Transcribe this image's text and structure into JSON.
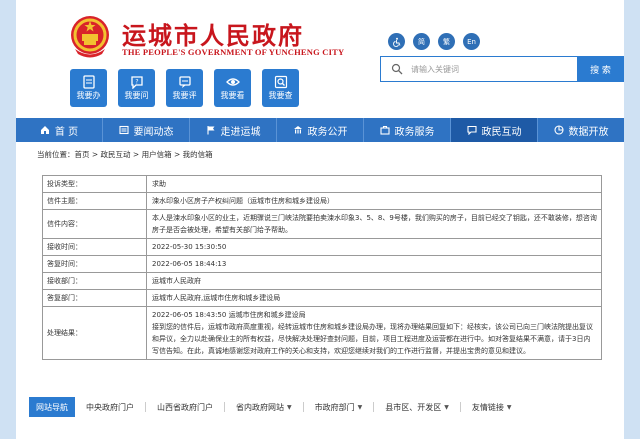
{
  "header": {
    "site_title": "运城市人民政府",
    "site_subtitle": "THE PEOPLE'S GOVERNMENT OF YUNCHENG  CITY",
    "quick_links": [
      {
        "label": "我要办",
        "icon": "form-icon"
      },
      {
        "label": "我要问",
        "icon": "question-icon"
      },
      {
        "label": "我要评",
        "icon": "feedback-icon"
      },
      {
        "label": "我要看",
        "icon": "eye-icon"
      },
      {
        "label": "我要查",
        "icon": "search-icon"
      }
    ],
    "accessibility": [
      {
        "label": "",
        "icon": "wheelchair-icon"
      },
      {
        "label": "简"
      },
      {
        "label": "繁"
      },
      {
        "label": "En"
      }
    ]
  },
  "search": {
    "placeholder": "请输入关键词",
    "button_label": "搜 索"
  },
  "nav": [
    {
      "label": "首 页",
      "icon": "home-icon"
    },
    {
      "label": "要闻动态",
      "icon": "news-icon"
    },
    {
      "label": "走进运城",
      "icon": "flag-icon"
    },
    {
      "label": "政务公开",
      "icon": "building-icon"
    },
    {
      "label": "政务服务",
      "icon": "service-icon"
    },
    {
      "label": "政民互动",
      "icon": "chat-icon",
      "active": true
    },
    {
      "label": "数据开放",
      "icon": "data-icon"
    }
  ],
  "breadcrumb": "当前位置：首页 > 政民互动 > 用户信箱 > 我的信箱",
  "letter": {
    "rows": [
      {
        "key": "投诉类型：",
        "value": "求助"
      },
      {
        "key": "信件主题：",
        "value": "涑水印象小区房子产权纠问题（运城市住房和城乡建设局）"
      },
      {
        "key": "信件内容：",
        "value": "本人是涑水印象小区的业主，近期骤说三门峡法院要拍卖涑水印象3、5、8、9号楼，我们购买的房子，目前已经交了钥匙，还不敢装修，想咨询房子是否会被处理，希望有关部门给予帮助。"
      },
      {
        "key": "接收时间：",
        "value": "2022-05-30 15:30:50"
      },
      {
        "key": "答复时间：",
        "value": "2022-06-05 18:44:13"
      },
      {
        "key": "接收部门：",
        "value": "运城市人民政府"
      },
      {
        "key": "答复部门：",
        "value": "运城市人民政府,运城市住房和城乡建设局"
      },
      {
        "key": "处理结果：",
        "value": "2022-06-05 18:43:50 运城市住房和城乡建设局",
        "detail": "接到您的信件后，运城市政府高度重视，经转运城市住房和城乡建设局办理，现将办理结果回复如下：经核实，该公司已向三门峡法院提出复议和异议，全力以赴确保业主的所有权益，尽快解决处理好查封问题，目前，项目工程进度及运营都在进行中。如对答复结果不满意，请于3日内写信告知。在此，真诚地感谢您对政府工作的关心和支持，欢迎您继续对我们的工作进行监督，并提出宝贵的意见和建议。"
      }
    ]
  },
  "footer": {
    "title": "网站导航",
    "items": [
      {
        "label": "中央政府门户",
        "has_caret": false
      },
      {
        "label": "山西省政府门户",
        "has_caret": false
      },
      {
        "label": "省内政府网站",
        "has_caret": true
      },
      {
        "label": "市政府部门",
        "has_caret": true
      },
      {
        "label": "县市区、开发区",
        "has_caret": true
      },
      {
        "label": "友情链接",
        "has_caret": true
      }
    ]
  },
  "colors": {
    "brand_red": "#c8161d",
    "primary_blue": "#2b7bd0",
    "nav_blue": "#2f73c3",
    "page_bg": "#cfe1f3"
  }
}
